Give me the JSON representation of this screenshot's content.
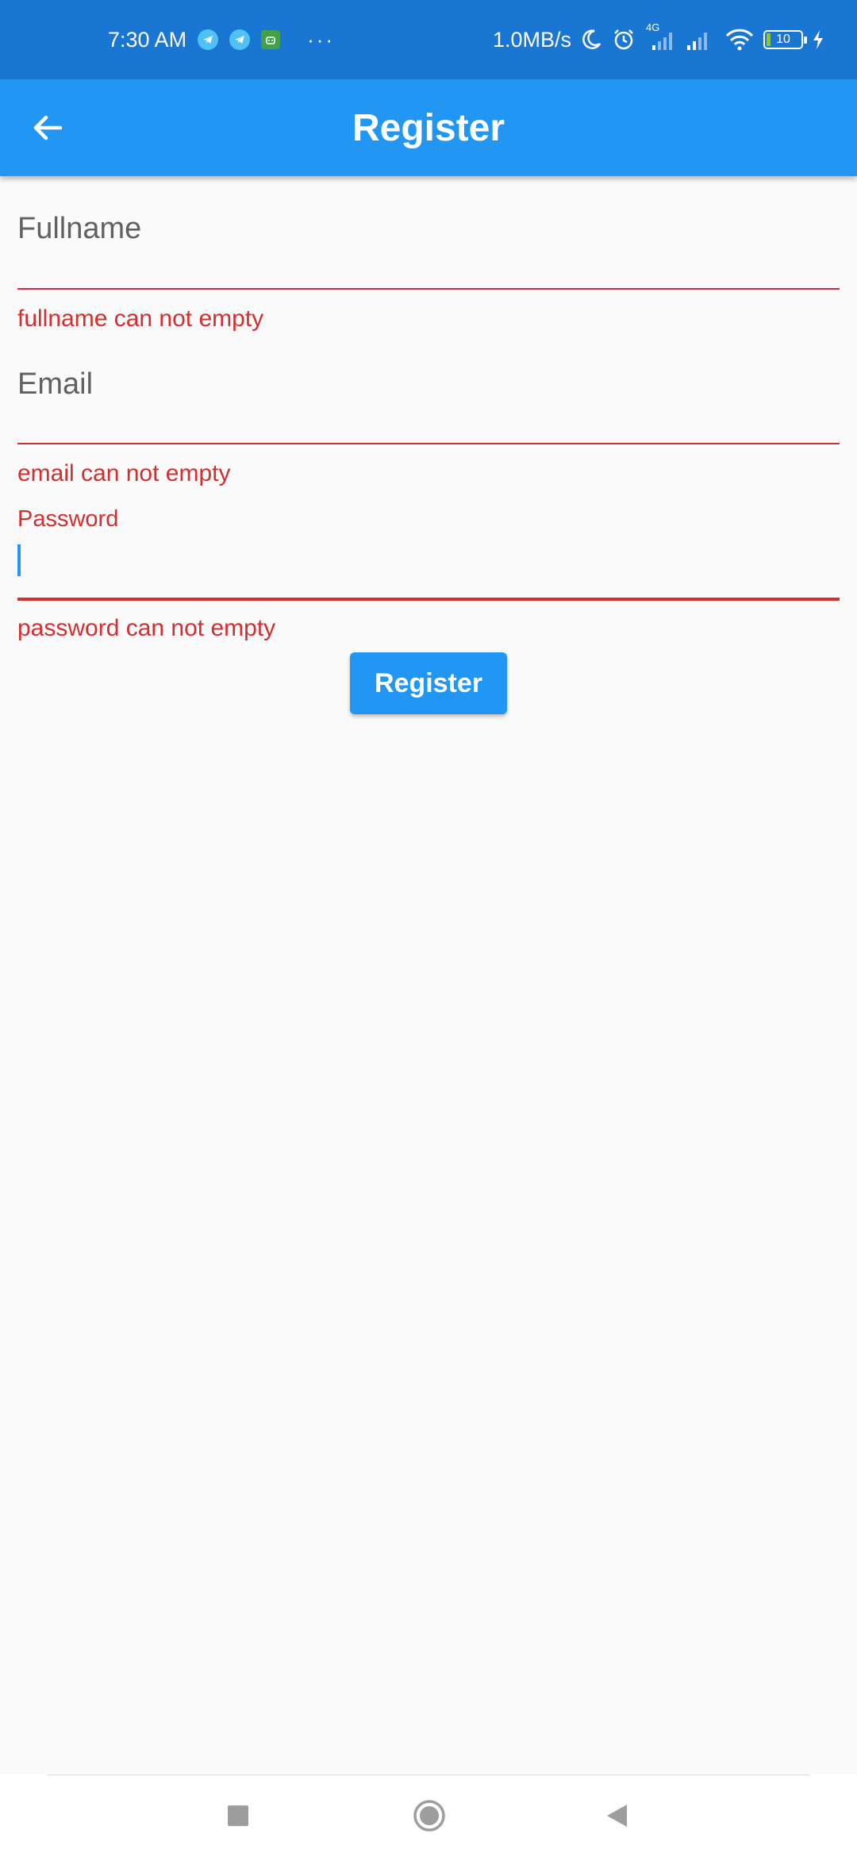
{
  "status_bar": {
    "time": "7:30 AM",
    "more": "···",
    "speed": "1.0MB/s",
    "network": "4G",
    "battery": "10",
    "icons": [
      "telegram-icon",
      "telegram-icon",
      "android-icon",
      "moon-icon",
      "alarm-icon",
      "signal-icon",
      "signal-icon",
      "wifi-icon",
      "battery-icon",
      "charging-icon"
    ]
  },
  "app_bar": {
    "title": "Register",
    "back_icon": "arrow-back-icon"
  },
  "form": {
    "fullname": {
      "label": "Fullname",
      "value": "",
      "error": "fullname can not empty"
    },
    "email": {
      "label": "Email",
      "value": "",
      "error": "email can not empty"
    },
    "password": {
      "label": "Password",
      "value": "",
      "error": "password can not empty",
      "focused": true
    },
    "submit_label": "Register"
  },
  "nav_bar": {
    "icons": [
      "recents-square-icon",
      "home-circle-icon",
      "back-triangle-icon"
    ]
  },
  "colors": {
    "status_bar": "#1976d2",
    "primary": "#2196f3",
    "error": "#d32f2f",
    "background": "#fafafa"
  }
}
